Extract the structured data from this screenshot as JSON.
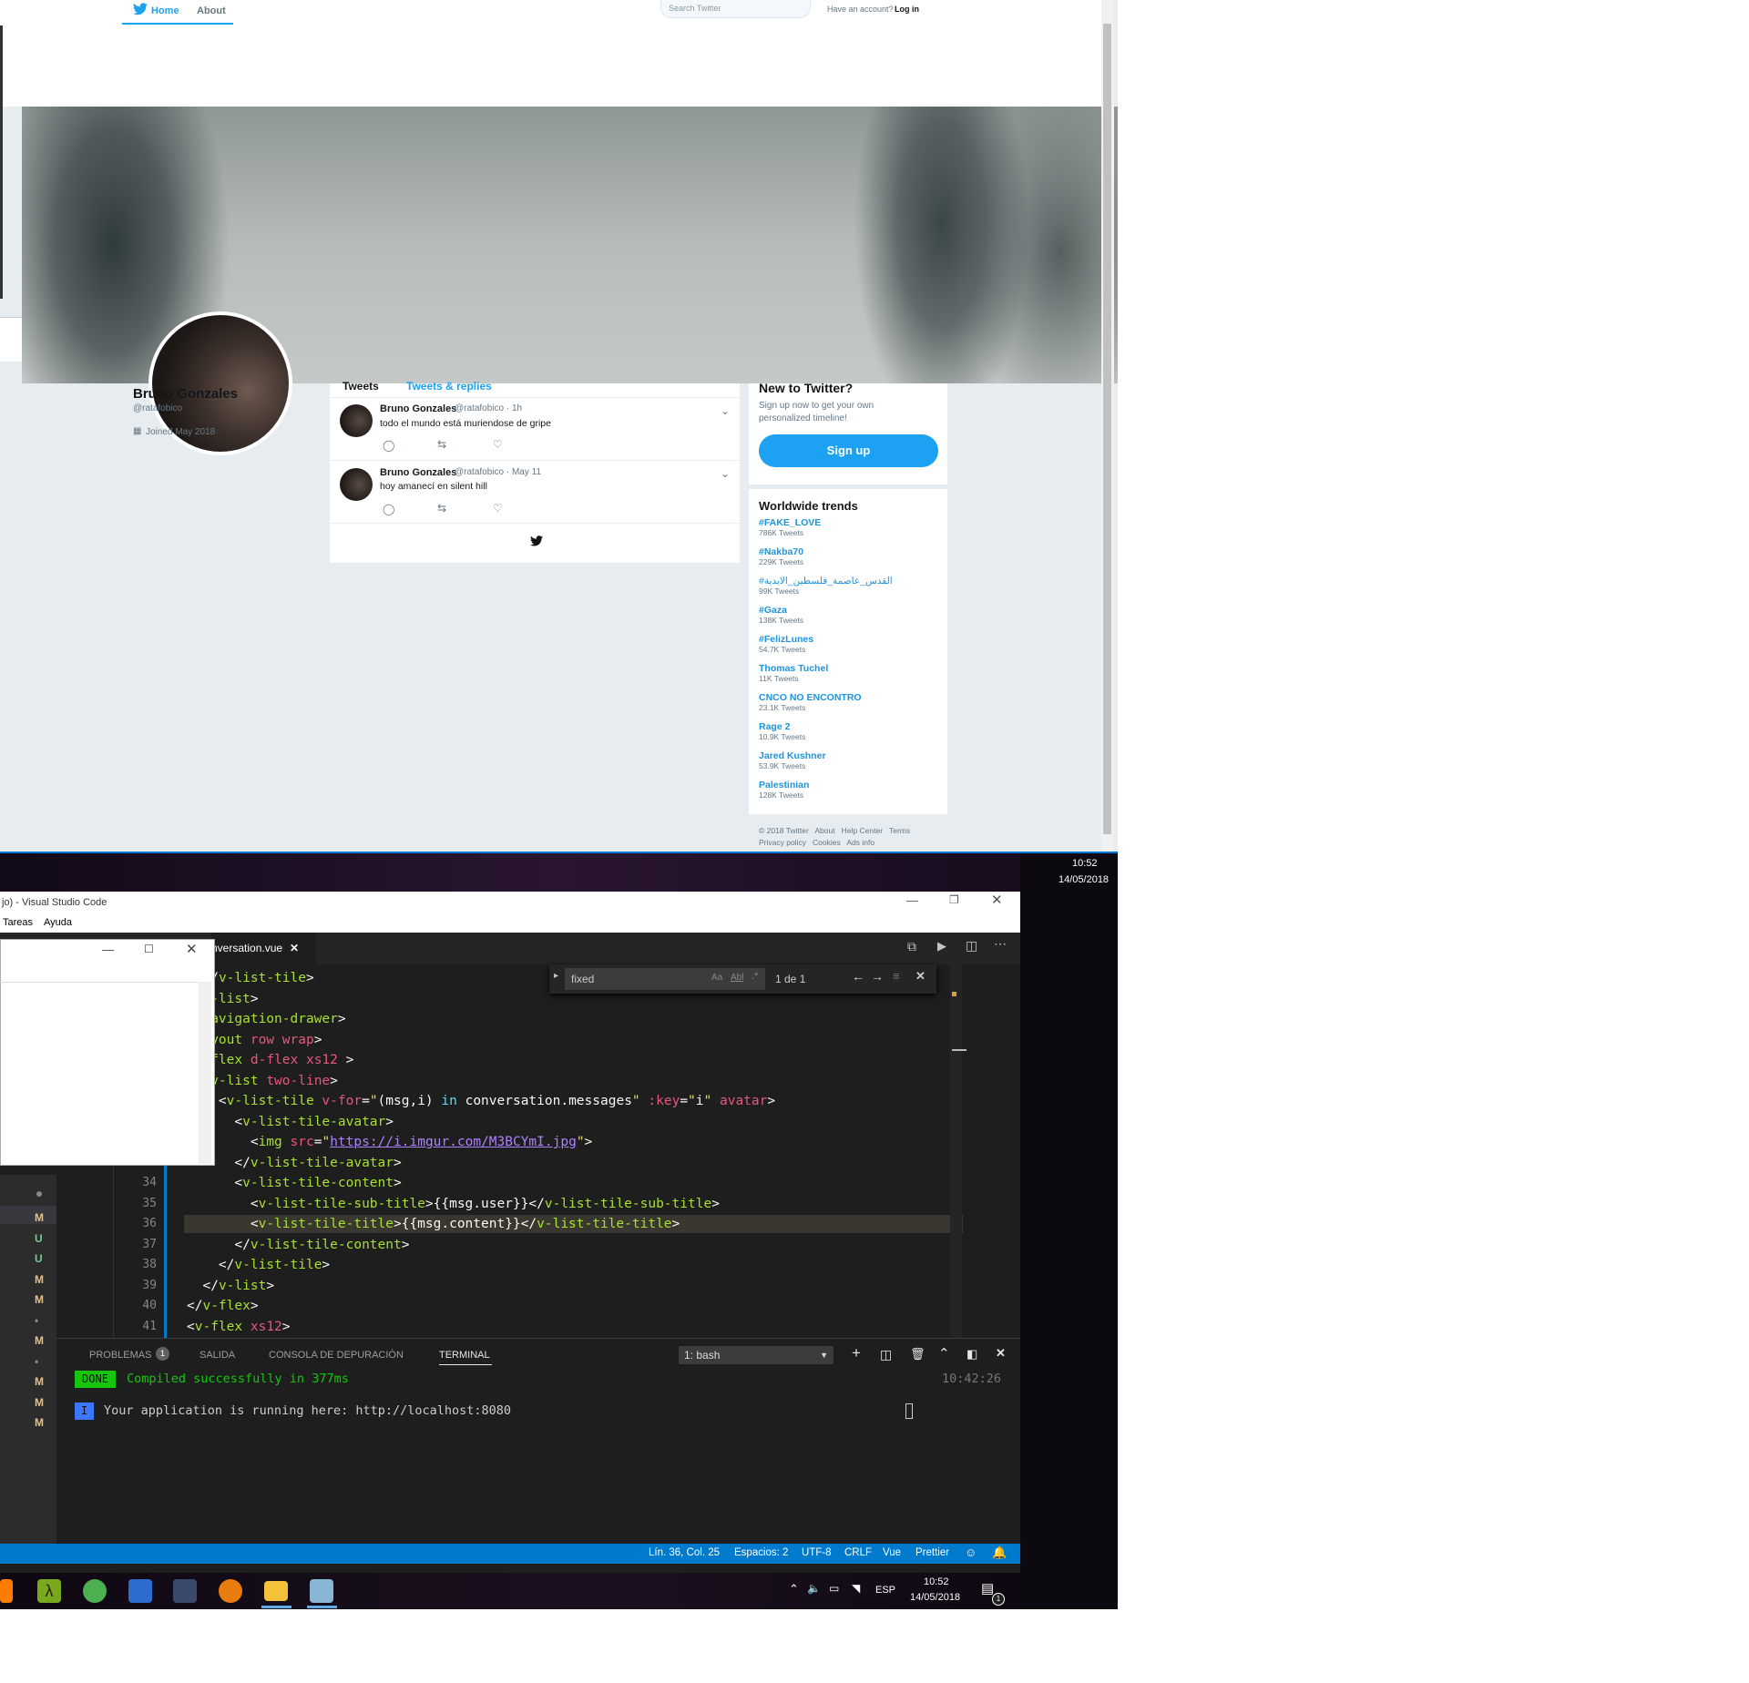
{
  "twitter": {
    "nav": {
      "home": "Home",
      "about": "About",
      "search_placeholder": "Search Twitter",
      "have_account": "Have an account?",
      "login": "Log in"
    },
    "profile": {
      "name": "Bruno Gonzales",
      "handle": "@ratafobico",
      "joined": "Joined May 2018"
    },
    "tabs": {
      "tweets": "Tweets",
      "replies": "Tweets & replies"
    },
    "tweets": [
      {
        "name": "Bruno Gonzales",
        "meta": "@ratafobico · 1h",
        "text": "todo el mundo está muriendose de gripe"
      },
      {
        "name": "Bruno Gonzales",
        "meta": "@ratafobico · May 11",
        "text": "hoy amanecí en silent hill"
      }
    ],
    "new_to_twitter": {
      "title": "New to Twitter?",
      "desc1": "Sign up now to get your own",
      "desc2": "personalized timeline!",
      "button": "Sign up"
    },
    "trends_title": "Worldwide trends",
    "trends": [
      {
        "name": "#FAKE_LOVE",
        "count": "786K Tweets"
      },
      {
        "name": "#Nakba70",
        "count": "229K Tweets"
      },
      {
        "name": "#القدس_عاصمة_فلسطين_الابدية",
        "count": "99K Tweets"
      },
      {
        "name": "#Gaza",
        "count": "138K Tweets"
      },
      {
        "name": "#FelizLunes",
        "count": "54.7K Tweets"
      },
      {
        "name": "Thomas Tuchel",
        "count": "11K Tweets"
      },
      {
        "name": "CNCO NO ENCONTRO",
        "count": "23.1K Tweets"
      },
      {
        "name": "Rage 2",
        "count": "10.9K Tweets"
      },
      {
        "name": "Jared Kushner",
        "count": "53.9K Tweets"
      },
      {
        "name": "Palestinian",
        "count": "128K Tweets"
      }
    ],
    "footer1": "© 2018 Twitter   About   Help Center   Terms",
    "footer2": "Privacy policy   Cookies   Ads info"
  },
  "desktop_clock": {
    "time": "10:52",
    "date": "14/05/2018"
  },
  "vscode": {
    "title": "jo) - Visual Studio Code",
    "menu": [
      "Tareas",
      "Ayuda"
    ],
    "tab": "nversation.vue",
    "find": {
      "query": "fixed",
      "result": "1 de 1",
      "opt_case": "Aa",
      "opt_word": "Abl"
    },
    "line_numbers": [
      "34",
      "35",
      "36",
      "37",
      "38",
      "39",
      "40",
      "41"
    ],
    "scm_markers": [
      "M",
      "U",
      "U",
      "M",
      "M",
      "M",
      "M",
      "M",
      "M"
    ],
    "code_url": "https://i.imgur.com/M3BCYmI.jpg",
    "panel": {
      "problems": "PROBLEMAS",
      "problems_count": "1",
      "output": "SALIDA",
      "debug": "CONSOLA DE DEPURACIÓN",
      "terminal": "TERMINAL",
      "shell": "1: bash"
    },
    "terminal": {
      "done": "DONE",
      "compiled": "Compiled successfully in 377ms",
      "time": "10:42:26",
      "info": "I",
      "running": "Your application is running here: http://localhost:8080"
    },
    "status": {
      "position": "Lín. 36, Col. 25",
      "spaces": "Espacios: 2",
      "encoding": "UTF-8",
      "eol": "CRLF",
      "lang": "Vue",
      "formatter": "Prettier"
    }
  },
  "taskbar": {
    "lang": "ESP",
    "time": "10:52",
    "date": "14/05/2018",
    "notif_count": "1"
  },
  "colors": {
    "twitter_blue": "#1da1f2",
    "vscode_status": "#007acc",
    "done_green": "#16c60c"
  }
}
